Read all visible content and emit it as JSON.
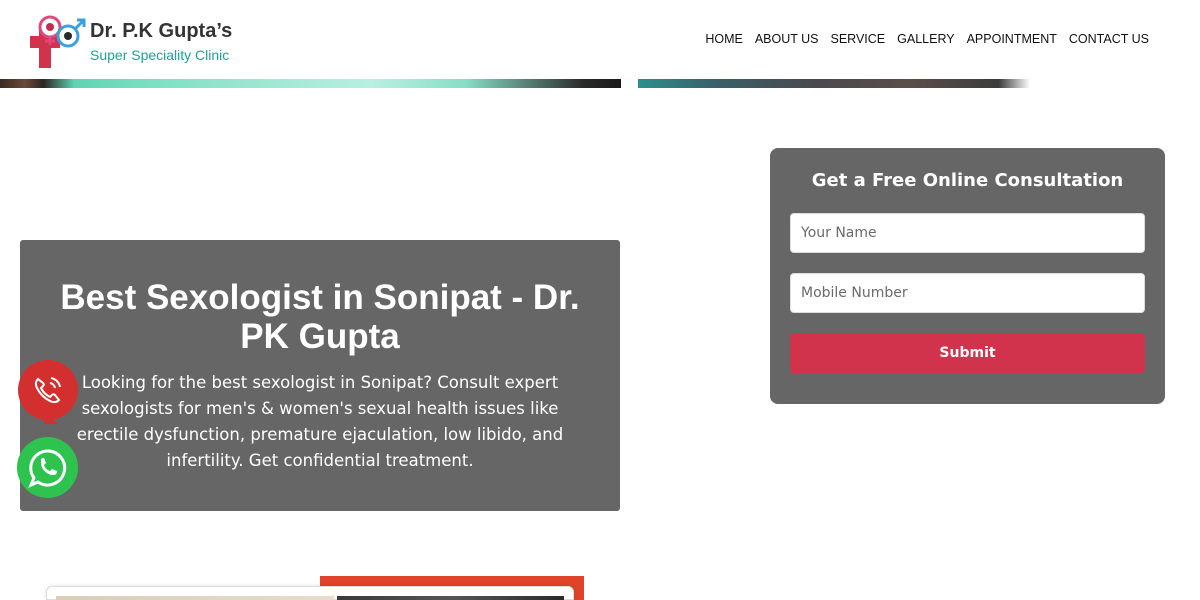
{
  "header": {
    "logo_title": "Dr. P.K Gupta’s",
    "logo_subtitle": "Super Speciality Clinic",
    "nav": [
      {
        "label": "HOME"
      },
      {
        "label": "ABOUT US"
      },
      {
        "label": "SERVICE"
      },
      {
        "label": "GALLERY"
      },
      {
        "label": "APPOINTMENT"
      },
      {
        "label": "CONTACT US"
      }
    ]
  },
  "banner": {
    "title": "Best Sexologist in Sonipat - Dr. PK Gupta",
    "description": "Looking for the best sexologist in Sonipat? Consult expert sexologists for men's & women's sexual health issues like erectile dysfunction, premature ejaculation, low libido, and infertility. Get confidential treatment."
  },
  "form": {
    "title": "Get a Free Online Consultation",
    "name_placeholder": "Your Name",
    "mobile_placeholder": "Mobile Number",
    "submit_label": "Submit"
  },
  "floating": {
    "call_icon": "phone-call-icon",
    "whatsapp_icon": "whatsapp-icon"
  },
  "colors": {
    "accent": "#d1334d",
    "card_bg": "#666666",
    "call_red": "#d32f2f",
    "whatsapp_green": "#2ec24f",
    "brand_teal": "#1aa39a"
  }
}
